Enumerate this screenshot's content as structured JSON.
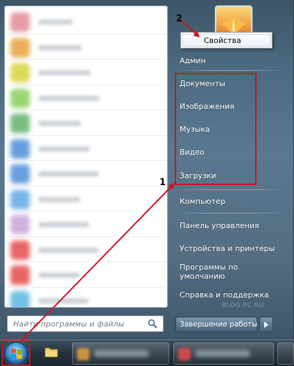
{
  "user_menu": {
    "user_name": "Админ",
    "library_items": [
      {
        "name": "documents",
        "label": "Документы"
      },
      {
        "name": "pictures",
        "label": "Изображения"
      },
      {
        "name": "music",
        "label": "Музыка"
      },
      {
        "name": "videos",
        "label": "Видео"
      },
      {
        "name": "downloads",
        "label": "Загрузки"
      }
    ],
    "system_items": [
      {
        "name": "computer",
        "label": "Компьютер"
      },
      {
        "name": "control-panel",
        "label": "Панель управления"
      },
      {
        "name": "devices-printers",
        "label": "Устройства и принтеры"
      },
      {
        "name": "default-programs",
        "label": "Программы по умолчанию"
      },
      {
        "name": "help-support",
        "label": "Справка и поддержка"
      }
    ]
  },
  "search": {
    "placeholder": "Найти программы и файлы"
  },
  "shutdown": {
    "label": "Завершение работы"
  },
  "context_menu": {
    "label": "Свойства"
  },
  "annotations": {
    "step1": "1",
    "step2": "2",
    "accent_color": "#c8141e"
  },
  "watermark": "BLOG-PC.RU",
  "blurred_program_colors": [
    "#e08a95",
    "#e8a13a",
    "#d8d23a",
    "#8bcf5a",
    "#5fb36b",
    "#4d8fd6",
    "#4d8fd6",
    "#5fa8e6",
    "#c9a4d8",
    "#e64a4a",
    "#e64a4a",
    "#5ab5e0"
  ]
}
